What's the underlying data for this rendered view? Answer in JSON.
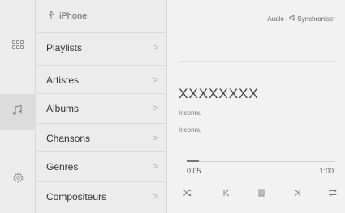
{
  "header": {
    "device_name": "iPhone",
    "device_icon": "usb-icon"
  },
  "rail": {
    "items": [
      {
        "name": "apps",
        "icon": "grid-icon"
      },
      {
        "name": "media",
        "icon": "music-note-icon"
      },
      {
        "name": "settings",
        "icon": "gear-icon"
      }
    ]
  },
  "list": {
    "items": [
      {
        "label": "Playlists"
      },
      {
        "label": "Artistes"
      },
      {
        "label": "Albums"
      },
      {
        "label": "Chansons"
      },
      {
        "label": "Genres"
      },
      {
        "label": "Compositeurs"
      }
    ],
    "chevron": ">"
  },
  "player": {
    "source_label": "Audio :",
    "source_value": "Synchroniser",
    "title": "XXXXXXXX",
    "artist": "Inconnu",
    "album": "Inconnu",
    "elapsed": "0:05",
    "total": "1:00",
    "progress_fraction": 0.08,
    "controls": [
      "shuffle-icon",
      "previous-icon",
      "pause-icon",
      "next-icon",
      "repeat-icon"
    ]
  },
  "colors": {
    "background": "#ececec",
    "panel": "#f2f2f2",
    "text": "#333333",
    "muted": "#777777"
  }
}
